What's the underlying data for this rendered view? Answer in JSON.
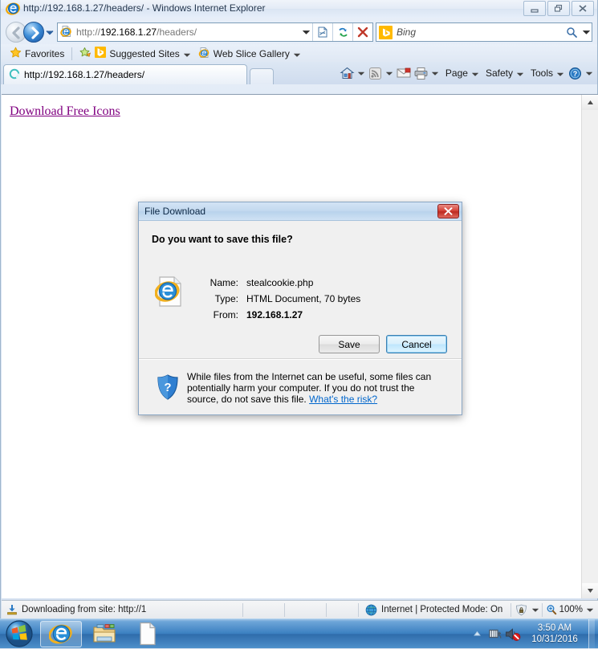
{
  "window": {
    "title": "http://192.168.1.27/headers/ - Windows Internet Explorer",
    "controls": {
      "minimize_label": "Minimize",
      "restore_label": "Restore",
      "close_label": "Close"
    }
  },
  "navigation": {
    "back_label": "Back",
    "forward_label": "Forward",
    "recent_pages_label": "Recent Pages",
    "address": {
      "value": "http://192.168.1.27/headers/",
      "scheme": "http://",
      "host": "192.168.1.27",
      "path": "/headers/",
      "dropdown_label": "Address dropdown",
      "compat_view_label": "Compatibility View",
      "refresh_label": "Refresh",
      "stop_label": "Stop"
    },
    "search": {
      "provider": "Bing",
      "placeholder": "Bing",
      "go_label": "Search",
      "dropdown_label": "Search options"
    }
  },
  "favorites_bar": {
    "favorites_label": "Favorites",
    "items": [
      {
        "label": "Suggested Sites",
        "has_caret": true
      },
      {
        "label": "Web Slice Gallery",
        "has_caret": true
      }
    ]
  },
  "tabs": [
    {
      "label": "http://192.168.1.27/headers/",
      "loading": true
    }
  ],
  "new_tab_label": "New Tab",
  "command_bar": {
    "icons": [
      {
        "name": "home-icon",
        "caret": true
      },
      {
        "name": "feeds-icon",
        "caret": true
      },
      {
        "name": "mail-icon",
        "caret": false
      },
      {
        "name": "print-icon",
        "caret": true
      }
    ],
    "menus": [
      {
        "label": "Page"
      },
      {
        "label": "Safety"
      },
      {
        "label": "Tools"
      }
    ],
    "help_label": "Help"
  },
  "page": {
    "link_text": "Download Free Icons",
    "link_color": "#800080"
  },
  "dialog": {
    "title": "File Download",
    "close_label": "Close",
    "question": "Do you want to save this file?",
    "fields": [
      {
        "label": "Name:",
        "value": "stealcookie.php",
        "bold": false
      },
      {
        "label": "Type:",
        "value": "HTML Document, 70 bytes",
        "bold": false
      },
      {
        "label": "From:",
        "value": "192.168.1.27",
        "bold": true
      }
    ],
    "buttons": {
      "save": "Save",
      "cancel": "Cancel"
    },
    "warning_text": "While files from the Internet can be useful, some files can potentially harm your computer. If you do not trust the source, do not save this file. ",
    "risk_link": "What's the risk?"
  },
  "status_bar": {
    "download_text": "Downloading from site: http://1",
    "zone_text": "Internet | Protected Mode: On",
    "zoom_level": "100%"
  },
  "taskbar": {
    "start_label": "Start",
    "items": [
      {
        "name": "taskbar-item-internet-explorer",
        "active": true
      },
      {
        "name": "taskbar-item-windows-explorer",
        "active": false
      },
      {
        "name": "taskbar-item-document",
        "active": false
      }
    ],
    "tray": {
      "show_hidden_label": "Show hidden icons",
      "network_label": "Network",
      "volume_label": "Volume muted",
      "time": "3:50 AM",
      "date": "10/31/2016"
    }
  }
}
